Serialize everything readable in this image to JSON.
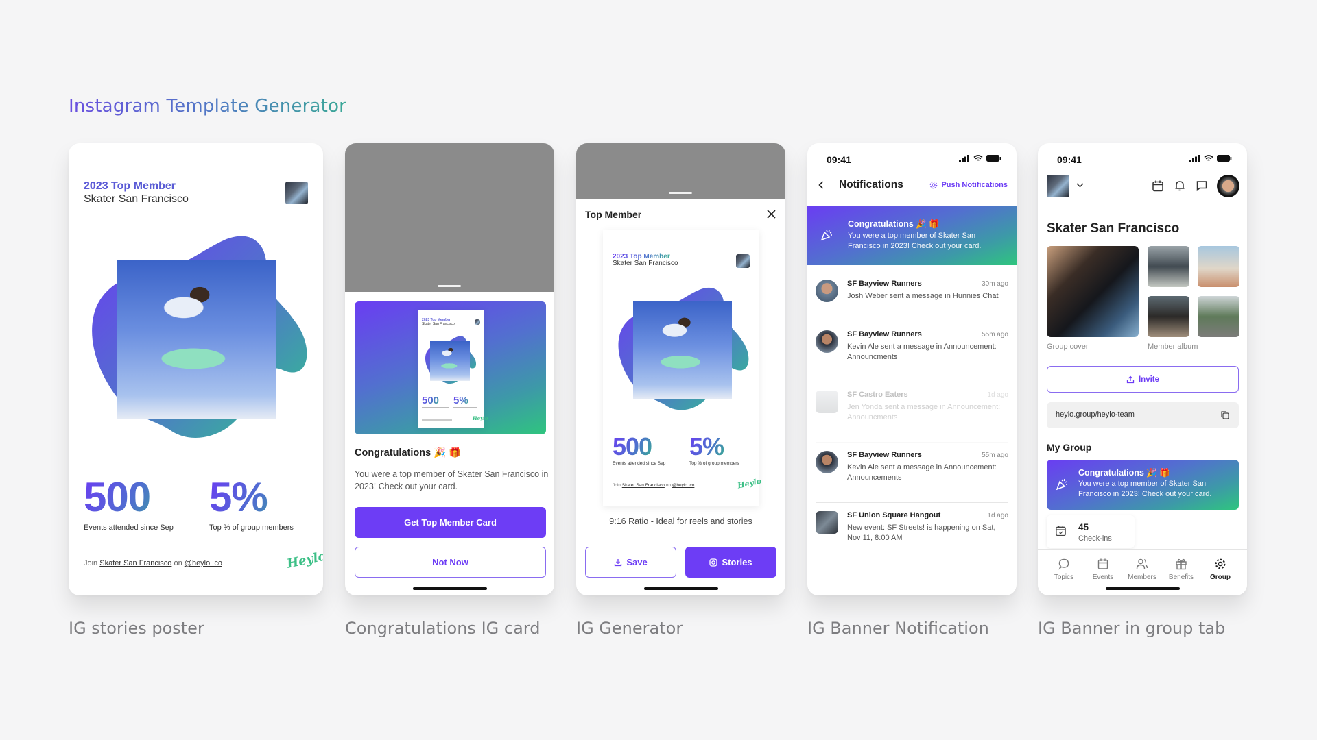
{
  "page": {
    "title": "Instagram Template Generator",
    "colors": {
      "accent": "#6d3df5",
      "gradient_start": "#6a3df2",
      "gradient_end": "#2fc57e",
      "background": "#f5f5f6"
    }
  },
  "captions": [
    "IG stories poster",
    "Congratulations IG card",
    "IG Generator",
    "IG Banner Notification",
    "IG Banner in group tab"
  ],
  "poster": {
    "headline": "2023 Top Member",
    "group": "Skater San Francisco",
    "stats": [
      {
        "value": "500",
        "label": "Events attended since Sep"
      },
      {
        "value": "5%",
        "label": "Top % of group members"
      }
    ],
    "join_prefix": "Join",
    "join_group": "Skater San Francisco",
    "join_middle": "on",
    "join_handle": "@heylo_co",
    "logo": "Heylo"
  },
  "congrats_card": {
    "title": "Congratulations 🎉 🎁",
    "body": "You were a top member of Skater San Francisco in 2023! Check out your card.",
    "primary_button": "Get Top Member Card",
    "secondary_button": "Not Now"
  },
  "generator": {
    "sheet_title": "Top Member",
    "ratio_note": "9:16 Ratio - Ideal for reels and stories",
    "save_button": "Save",
    "stories_button": "Stories"
  },
  "notifications": {
    "status_time": "09:41",
    "title": "Notifications",
    "push_link": "Push Notifications",
    "banner": {
      "title": "Congratulations 🎉 🎁",
      "text": "You were a top member of Skater San Francisco in 2023! Check out your card."
    },
    "items": [
      {
        "group": "SF Bayview Runners",
        "time": "30m ago",
        "message": "Josh Weber sent a message in Hunnies Chat",
        "faded": false
      },
      {
        "group": "SF Bayview Runners",
        "time": "55m ago",
        "message": "Kevin Ale sent a message in Announcement: Announcments",
        "faded": false
      },
      {
        "group": "SF Castro Eaters",
        "time": "1d ago",
        "message": "Jen Yonda sent a message in Announcement: Announcments",
        "faded": true
      },
      {
        "group": "SF Bayview Runners",
        "time": "55m ago",
        "message": "Kevin Ale sent a message in Announcement: Announcements",
        "faded": false
      },
      {
        "group": "SF Union Square Hangout",
        "time": "1d ago",
        "message": "New event: SF Streets! is happening on Sat, Nov 11, 8:00 AM",
        "faded": false
      }
    ]
  },
  "group_tab": {
    "status_time": "09:41",
    "group_name": "Skater San Francisco",
    "cover_label": "Group cover",
    "album_label": "Member album",
    "invite_button": "Invite",
    "invite_link": "heylo.group/heylo-team",
    "section_title": "My Group",
    "banner": {
      "title": "Congratulations 🎉 🎁",
      "text": "You were a top member of Skater San Francisco in 2023! Check out your card."
    },
    "checkins": {
      "value": "45",
      "label": "Check-ins"
    },
    "tabs": [
      {
        "label": "Topics",
        "icon": "chat-bubble-icon",
        "active": false
      },
      {
        "label": "Events",
        "icon": "calendar-icon",
        "active": false
      },
      {
        "label": "Members",
        "icon": "members-icon",
        "active": false
      },
      {
        "label": "Benefits",
        "icon": "gift-icon",
        "active": false
      },
      {
        "label": "Group",
        "icon": "gear-icon",
        "active": true
      }
    ]
  }
}
